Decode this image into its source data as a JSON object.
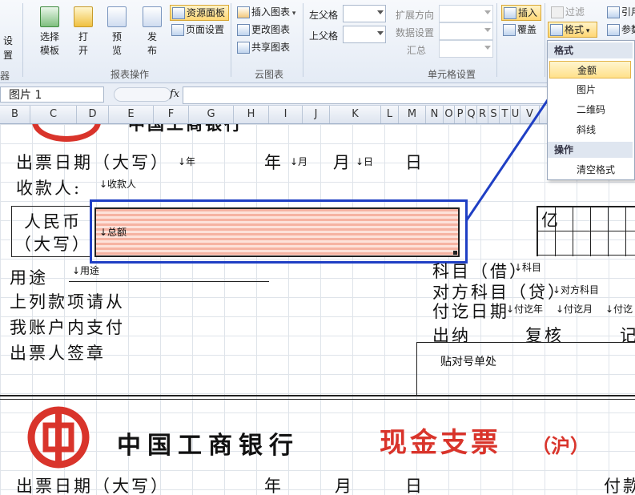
{
  "ribbon": {
    "left_partial": [
      "设",
      "置",
      "器"
    ],
    "report_group": {
      "buttons": [
        {
          "label": "选择\n模板"
        },
        {
          "label": "打\n开"
        },
        {
          "label": "预\n览"
        },
        {
          "label": "发\n布"
        }
      ],
      "resource_panel": "资源面板",
      "page_setup": "页面设置",
      "label": "报表操作"
    },
    "cloud_group": {
      "insert_chart": "插入图表",
      "change_chart": "更改图表",
      "share_chart": "共享图表",
      "label": "云图表"
    },
    "cell_group": {
      "left_parent": "左父格",
      "top_parent": "上父格",
      "expand_direction": "扩展方向",
      "data_setting": "数据设置",
      "summary": "汇总",
      "label": "单元格设置"
    },
    "insert_label": "插入",
    "cover_label": "覆盖",
    "filter_label": "过滤",
    "format_label": "格式",
    "ref_label": "引用",
    "param_label": "参数"
  },
  "formula_bar": {
    "name_box": "图片 1",
    "fx": "fx"
  },
  "columns": [
    "B",
    "C",
    "D",
    "E",
    "F",
    "G",
    "H",
    "I",
    "J",
    "K",
    "L",
    "M",
    "N",
    "O",
    "P",
    "Q",
    "R",
    "S",
    "T",
    "U",
    "V"
  ],
  "sheet": {
    "top_title": "中国工商银行",
    "issue_date": "出票日期（大写）",
    "year_field": "↓年",
    "year": "年",
    "month_field": "↓月",
    "month": "月",
    "day_field": "↓日",
    "day": "日",
    "payee": "收款人:",
    "payee_field": "↓收款人",
    "rmb": "人民币",
    "daxie": "（大写）",
    "total_field": "↓总额",
    "purpose": "用途",
    "purpose_field": "↓用途",
    "line1": "上列款项请从",
    "line2": "我账户内支付",
    "line3": "出票人签章",
    "account_subject": "科目（借）",
    "account_field": "↓科目",
    "counter_subject": "对方科目（贷）",
    "counter_field": "↓对方科目",
    "pay_date": "付讫日期",
    "pay_year_field": "↓付讫年",
    "pay_month_field": "↓付讫月",
    "pay_day_field": "↓付讫",
    "cashier": "出纳",
    "review": "复核",
    "record": "记",
    "paste_here": "贴对号单处",
    "yi": "亿",
    "bottom_bank": "中国工商银行",
    "bottom_cheque": "现金支票",
    "bottom_region": "（沪）",
    "bottom_issue_date": "出票日期（大写）",
    "bottom_year": "年",
    "bottom_month": "月",
    "bottom_day": "日",
    "bottom_fu": "付款"
  },
  "menu": {
    "format_header": "格式",
    "items": [
      "金额",
      "图片",
      "二维码",
      "斜线"
    ],
    "selected": "金额",
    "ops_header": "操作",
    "clear": "清空格式"
  },
  "colors": {
    "accent_blue": "#1f3fc4",
    "bank_red": "#d9342b"
  }
}
